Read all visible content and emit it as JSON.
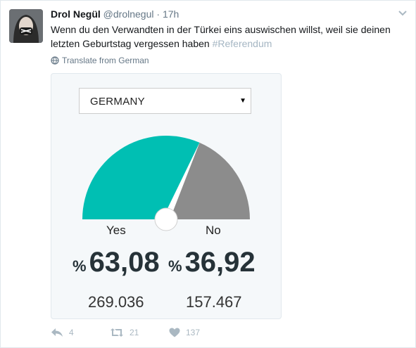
{
  "tweet": {
    "display_name": "Drol Negül",
    "handle": "@drolnegul",
    "separator": "·",
    "time": "17h",
    "text_main": "Wenn du den Verwandten in der Türkei eins auswischen willst, weil sie deinen letzten Geburtstag vergessen haben",
    "hashtag": "#Referendum",
    "translate_label": "Translate from German"
  },
  "card": {
    "dropdown_value": "GERMANY",
    "gauge": {
      "yes_fraction": 0.6308,
      "yes_color": "#00bfb3",
      "no_color": "#8c8c8c"
    },
    "yes_label": "Yes",
    "no_label": "No",
    "percent_symbol": "%",
    "yes_percent": "63,08",
    "no_percent": "36,92",
    "yes_votes": "269.036",
    "no_votes": "157.467"
  },
  "actions": {
    "reply_count": "4",
    "retweet_count": "21",
    "like_count": "137",
    "icon_color": "#aab8c2"
  }
}
